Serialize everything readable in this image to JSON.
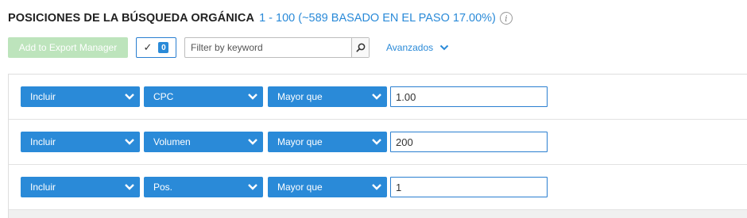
{
  "header": {
    "title": "POSICIONES DE LA BÚSQUEDA ORGÁNICA",
    "range": "1 - 100 (~589 BASADO EN EL PASO 17.00%)",
    "info_icon": "info-icon"
  },
  "toolbar": {
    "export_label": "Add to Export Manager",
    "selected_count": "0",
    "search_placeholder": "Filter by keyword",
    "advanced_label": "Avanzados"
  },
  "colors": {
    "accent": "#2a8ad8",
    "export_disabled": "#bde4bc"
  },
  "filters": [
    {
      "mode": "Incluir",
      "field": "CPC",
      "operator": "Mayor que",
      "value": "1.00"
    },
    {
      "mode": "Incluir",
      "field": "Volumen",
      "operator": "Mayor que",
      "value": "200"
    },
    {
      "mode": "Incluir",
      "field": "Pos.",
      "operator": "Mayor que",
      "value": "1"
    }
  ]
}
